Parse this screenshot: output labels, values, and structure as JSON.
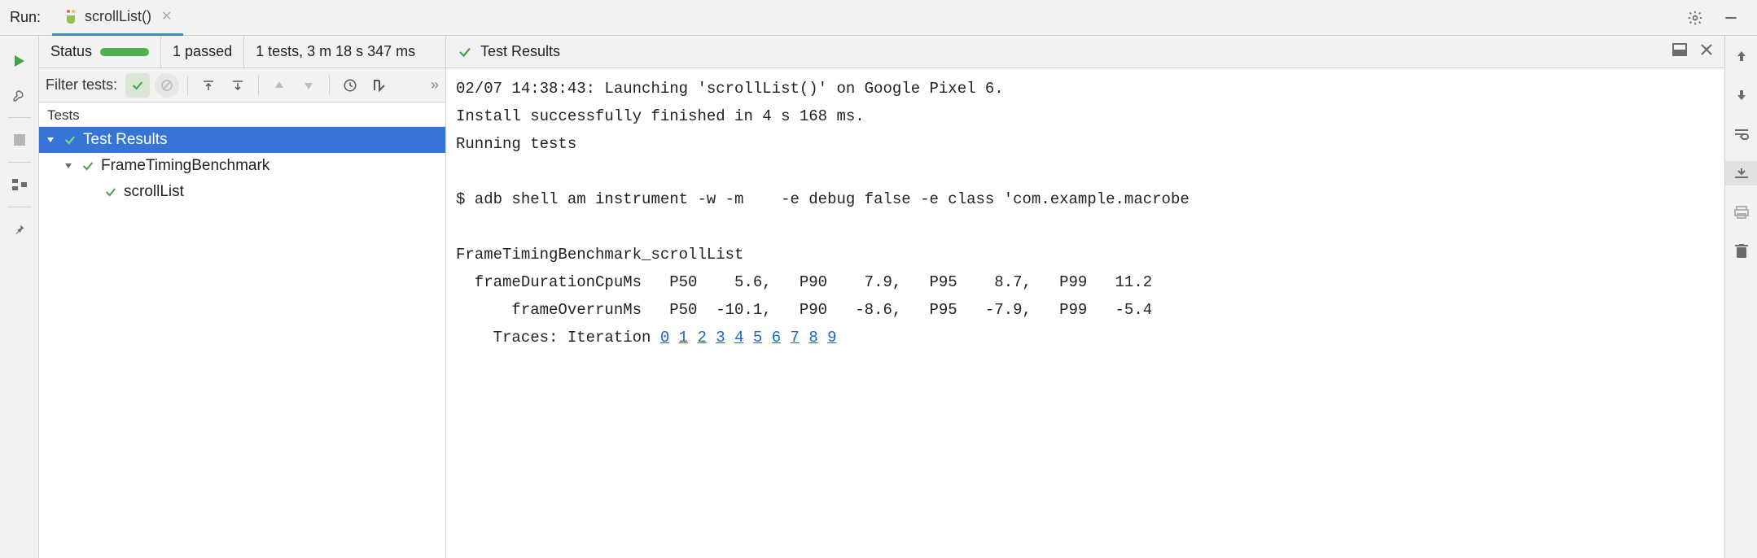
{
  "header": {
    "run_label": "Run:",
    "tab_name": "scrollList()"
  },
  "status": {
    "label": "Status",
    "passed_text": "1 passed",
    "tests_time": "1 tests, 3 m 18 s 347 ms",
    "results_title": "Test Results"
  },
  "filter": {
    "label": "Filter tests:"
  },
  "tree": {
    "header": "Tests",
    "root": "Test Results",
    "group": "FrameTimingBenchmark",
    "leaf": "scrollList"
  },
  "output": {
    "line1": "02/07 14:38:43: Launching 'scrollList()' on Google Pixel 6.",
    "line2": "Install successfully finished in 4 s 168 ms.",
    "line3": "Running tests",
    "line4": "",
    "line5": "$ adb shell am instrument -w -m    -e debug false -e class 'com.example.macrobe",
    "line6": "",
    "line7": "FrameTimingBenchmark_scrollList",
    "line8": "  frameDurationCpuMs   P50    5.6,   P90    7.9,   P95    8.7,   P99   11.2",
    "line9": "      frameOverrunMs   P50  -10.1,   P90   -8.6,   P95   -7.9,   P99   -5.4",
    "traces_label": "    Traces: Iteration ",
    "trace_links": [
      "0",
      "1",
      "2",
      "3",
      "4",
      "5",
      "6",
      "7",
      "8",
      "9"
    ]
  },
  "icons": {
    "gear": "gear-icon",
    "minimize": "minimize-icon"
  }
}
